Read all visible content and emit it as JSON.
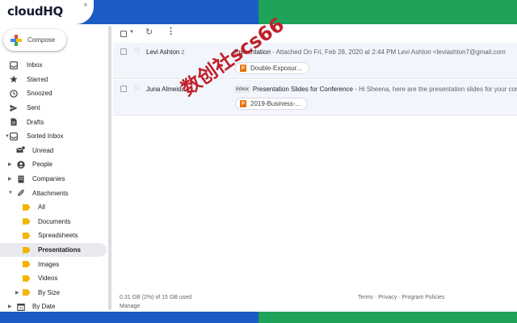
{
  "brand": {
    "logo": "cloudHQ",
    "trademark": "®"
  },
  "compose": {
    "label": "Compose"
  },
  "sidebar": {
    "items": [
      {
        "label": "Inbox",
        "icon": "inbox-icon",
        "level": 0,
        "arrow": ""
      },
      {
        "label": "Starred",
        "icon": "star-icon",
        "level": 0,
        "arrow": ""
      },
      {
        "label": "Snoozed",
        "icon": "clock-icon",
        "level": 0,
        "arrow": ""
      },
      {
        "label": "Sent",
        "icon": "send-icon",
        "level": 0,
        "arrow": ""
      },
      {
        "label": "Drafts",
        "icon": "draft-icon",
        "level": 0,
        "arrow": ""
      },
      {
        "label": "Sorted Inbox",
        "icon": "inbox-icon",
        "level": 0,
        "arrow": "down"
      },
      {
        "label": "Unread",
        "icon": "unread-mail-icon",
        "level": 1,
        "arrow": ""
      },
      {
        "label": "People",
        "icon": "person-icon",
        "level": 1,
        "arrow": "right"
      },
      {
        "label": "Companies",
        "icon": "building-icon",
        "level": 1,
        "arrow": "right"
      },
      {
        "label": "Attachments",
        "icon": "paperclip-icon",
        "level": 1,
        "arrow": "down"
      },
      {
        "label": "All",
        "icon": "label-tag-icon",
        "level": 2,
        "arrow": ""
      },
      {
        "label": "Documents",
        "icon": "label-tag-icon",
        "level": 2,
        "arrow": ""
      },
      {
        "label": "Spreadsheets",
        "icon": "label-tag-icon",
        "level": 2,
        "arrow": ""
      },
      {
        "label": "Presentations",
        "icon": "label-tag-icon",
        "level": 2,
        "arrow": "",
        "active": true
      },
      {
        "label": "Images",
        "icon": "label-tag-icon",
        "level": 2,
        "arrow": ""
      },
      {
        "label": "Videos",
        "icon": "label-tag-icon",
        "level": 2,
        "arrow": ""
      },
      {
        "label": "By Size",
        "icon": "label-tag-icon",
        "level": 2,
        "arrow": "right"
      },
      {
        "label": "By Date",
        "icon": "calendar-icon",
        "level": 1,
        "arrow": "right"
      }
    ]
  },
  "emails": [
    {
      "sender": "Levi Ashton",
      "count": "2",
      "badge": "",
      "subject": "Presentation",
      "snippet": " - Attached On Fri, Feb 28, 2020 at 2:44 PM Levi Ashton <leviashton7@gmail.com",
      "attachment": "Double-Exposur..."
    },
    {
      "sender": "Juna Almeida",
      "count": "",
      "badge": "Inbox",
      "subject": "Presentation Slides for Conference",
      "snippet": " - Hi Sheena, here are the presentation slides for your conf",
      "attachment": "2019-Business-..."
    }
  ],
  "footer": {
    "storage": "0.31 GB (2%) of 15 GB used",
    "manage": "Manage",
    "links": "Terms · Privacy · Program Policies"
  },
  "watermark": "数创社scs66",
  "colors": {
    "frame_left": "#1a5bc4",
    "frame_right": "#1fa25a",
    "tag": "#f4b400",
    "attachment": "#e8710a"
  }
}
